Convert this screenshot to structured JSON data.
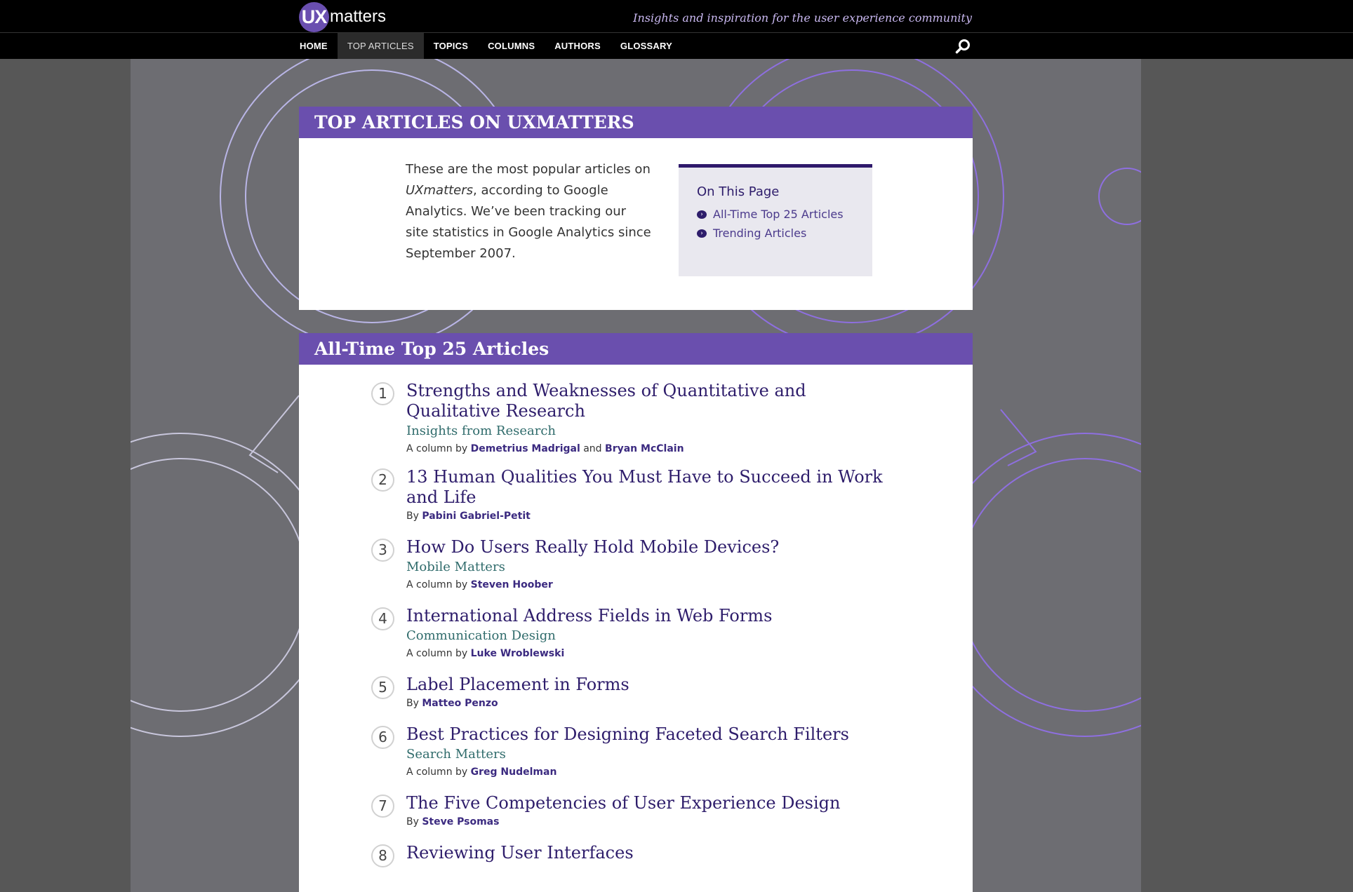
{
  "site": {
    "logo_mark": "UX",
    "logo_word": "matters",
    "tagline": "Insights and inspiration for the user experience community"
  },
  "nav": {
    "items": [
      {
        "label": "HOME"
      },
      {
        "label": "TOP ARTICLES"
      },
      {
        "label": "TOPICS"
      },
      {
        "label": "COLUMNS"
      },
      {
        "label": "AUTHORS"
      },
      {
        "label": "GLOSSARY"
      }
    ],
    "active_index": 1,
    "search_icon": "search-icon"
  },
  "intro": {
    "heading": "TOP ARTICLES ON UXMATTERS",
    "text_before": "These are the most popular articles on ",
    "text_em": "UXmatters",
    "text_after": ", according to Google Analytics. We’ve been tracking our site statistics in Google Analytics since September 2007."
  },
  "on_this_page": {
    "heading": "On This Page",
    "links": [
      {
        "label": "All-Time Top 25 Articles"
      },
      {
        "label": "Trending Articles"
      }
    ]
  },
  "top25": {
    "heading": "All-Time Top 25 Articles",
    "articles": [
      {
        "num": "1",
        "title": "Strengths and Weaknesses of Quantitative and Qualitative Research",
        "column": "Insights from Research",
        "by_prefix": "A column by ",
        "authors": [
          "Demetrius Madrigal",
          "Bryan McClain"
        ],
        "joiner": " and "
      },
      {
        "num": "2",
        "title": "13 Human Qualities You Must Have to Succeed in Work and Life",
        "column": "",
        "by_prefix": "By ",
        "authors": [
          "Pabini Gabriel-Petit"
        ],
        "joiner": ""
      },
      {
        "num": "3",
        "title": "How Do Users Really Hold Mobile Devices?",
        "column": "Mobile Matters",
        "by_prefix": "A column by ",
        "authors": [
          "Steven Hoober"
        ],
        "joiner": ""
      },
      {
        "num": "4",
        "title": "International Address Fields in Web Forms",
        "column": "Communication Design",
        "by_prefix": "A column by ",
        "authors": [
          "Luke Wroblewski"
        ],
        "joiner": ""
      },
      {
        "num": "5",
        "title": "Label Placement in Forms",
        "column": "",
        "by_prefix": "By ",
        "authors": [
          "Matteo Penzo"
        ],
        "joiner": ""
      },
      {
        "num": "6",
        "title": "Best Practices for Designing Faceted Search Filters",
        "column": "Search Matters",
        "by_prefix": "A column by ",
        "authors": [
          "Greg Nudelman"
        ],
        "joiner": ""
      },
      {
        "num": "7",
        "title": "The Five Competencies of User Experience Design",
        "column": "",
        "by_prefix": "By ",
        "authors": [
          "Steve Psomas"
        ],
        "joiner": ""
      },
      {
        "num": "8",
        "title": "Reviewing User Interfaces",
        "column": "",
        "by_prefix": "",
        "authors": [],
        "joiner": ""
      }
    ]
  },
  "colors": {
    "brand_purple": "#6a4fae",
    "dark_purple": "#2e1d6b",
    "column_teal": "#2f6b6b"
  }
}
